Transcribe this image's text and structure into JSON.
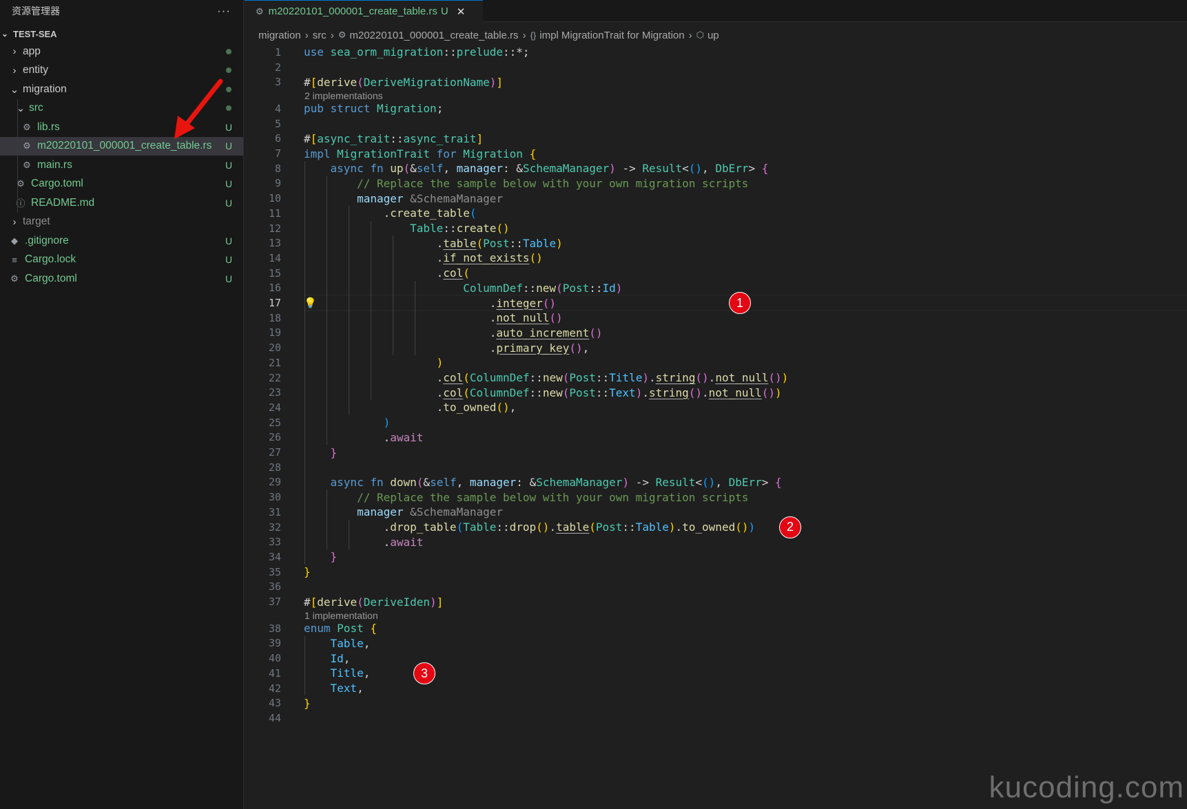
{
  "explorer": {
    "title": "资源管理器",
    "more": "···",
    "project": "TEST-SEA",
    "items": [
      {
        "label": "app",
        "kind": "folder",
        "open": false,
        "level": 0,
        "badge": "",
        "dot": true,
        "git": false,
        "selected": false
      },
      {
        "label": "entity",
        "kind": "folder",
        "open": false,
        "level": 0,
        "badge": "",
        "dot": true,
        "git": false,
        "selected": false
      },
      {
        "label": "migration",
        "kind": "folder",
        "open": true,
        "level": 0,
        "badge": "",
        "dot": true,
        "git": false,
        "selected": false
      },
      {
        "label": "src",
        "kind": "folder",
        "open": true,
        "level": 1,
        "badge": "",
        "dot": true,
        "git": true,
        "selected": false
      },
      {
        "label": "lib.rs",
        "kind": "rust",
        "open": false,
        "level": 2,
        "badge": "U",
        "dot": false,
        "git": true,
        "selected": false
      },
      {
        "label": "m20220101_000001_create_table.rs",
        "kind": "rust",
        "open": false,
        "level": 2,
        "badge": "U",
        "dot": false,
        "git": true,
        "selected": true
      },
      {
        "label": "main.rs",
        "kind": "rust",
        "open": false,
        "level": 2,
        "badge": "U",
        "dot": false,
        "git": true,
        "selected": false
      },
      {
        "label": "Cargo.toml",
        "kind": "gear",
        "open": false,
        "level": 1,
        "badge": "U",
        "dot": false,
        "git": true,
        "selected": false
      },
      {
        "label": "README.md",
        "kind": "info",
        "open": false,
        "level": 1,
        "badge": "U",
        "dot": false,
        "git": true,
        "selected": false
      },
      {
        "label": "target",
        "kind": "folder",
        "open": false,
        "level": 0,
        "badge": "",
        "dot": false,
        "git": false,
        "dim": true,
        "selected": false
      },
      {
        "label": ".gitignore",
        "kind": "diamond",
        "open": false,
        "level": 0,
        "badge": "U",
        "dot": false,
        "git": true,
        "selected": false
      },
      {
        "label": "Cargo.lock",
        "kind": "lines",
        "open": false,
        "level": 0,
        "badge": "U",
        "dot": false,
        "git": true,
        "selected": false
      },
      {
        "label": "Cargo.toml",
        "kind": "gear",
        "open": false,
        "level": 0,
        "badge": "U",
        "dot": false,
        "git": true,
        "selected": false
      }
    ]
  },
  "tab": {
    "label": "m20220101_000001_create_table.rs",
    "badge": "U",
    "close": "✕"
  },
  "breadcrumb": [
    {
      "label": "migration",
      "icon": ""
    },
    {
      "label": "src",
      "icon": ""
    },
    {
      "label": "m20220101_000001_create_table.rs",
      "icon": "rust-icon"
    },
    {
      "label": "impl MigrationTrait for Migration",
      "icon": "braces-icon"
    },
    {
      "label": "up",
      "icon": "cube-icon"
    }
  ],
  "editor": {
    "current_line": 17,
    "hints": [
      {
        "after_line": 3,
        "text": "2 implementations"
      },
      {
        "after_line": 37,
        "text": "1 implementation"
      }
    ],
    "lines": [
      [
        [
          "kw",
          "use"
        ],
        [
          "pl",
          " "
        ],
        [
          "ty",
          "sea_orm_migration"
        ],
        [
          "pl",
          "::"
        ],
        [
          "ty",
          "prelude"
        ],
        [
          "pl",
          "::*;"
        ]
      ],
      [],
      [
        [
          "pl",
          "#"
        ],
        [
          "b1",
          "["
        ],
        [
          "fn",
          "derive"
        ],
        [
          "b2",
          "("
        ],
        [
          "ty",
          "DeriveMigrationName"
        ],
        [
          "b2",
          ")"
        ],
        [
          "b1",
          "]"
        ]
      ],
      [
        [
          "kw",
          "pub"
        ],
        [
          "pl",
          " "
        ],
        [
          "kw",
          "struct"
        ],
        [
          "pl",
          " "
        ],
        [
          "ty",
          "Migration"
        ],
        [
          "pl",
          ";"
        ]
      ],
      [],
      [
        [
          "pl",
          "#"
        ],
        [
          "b1",
          "["
        ],
        [
          "ty",
          "async_trait"
        ],
        [
          "pl",
          "::"
        ],
        [
          "ty",
          "async_trait"
        ],
        [
          "b1",
          "]"
        ]
      ],
      [
        [
          "kw",
          "impl"
        ],
        [
          "pl",
          " "
        ],
        [
          "ty",
          "MigrationTrait"
        ],
        [
          "pl",
          " "
        ],
        [
          "kw",
          "for"
        ],
        [
          "pl",
          " "
        ],
        [
          "ty",
          "Migration"
        ],
        [
          "pl",
          " "
        ],
        [
          "b1",
          "{"
        ]
      ],
      [
        [
          "pl",
          "    "
        ],
        [
          "kw",
          "async"
        ],
        [
          "pl",
          " "
        ],
        [
          "kw",
          "fn"
        ],
        [
          "pl",
          " "
        ],
        [
          "fn",
          "up"
        ],
        [
          "b2",
          "("
        ],
        [
          "pl",
          "&"
        ],
        [
          "kw",
          "self"
        ],
        [
          "pl",
          ", "
        ],
        [
          "var",
          "manager"
        ],
        [
          "pl",
          ": &"
        ],
        [
          "ty",
          "SchemaManager"
        ],
        [
          "b2",
          ")"
        ],
        [
          "pl",
          " -> "
        ],
        [
          "ty",
          "Result"
        ],
        [
          "pl",
          "<"
        ],
        [
          "b3",
          "()"
        ],
        [
          "pl",
          ", "
        ],
        [
          "ty",
          "DbErr"
        ],
        [
          "pl",
          "> "
        ],
        [
          "b2",
          "{"
        ]
      ],
      [
        [
          "pl",
          "        "
        ],
        [
          "cm",
          "// Replace the sample below with your own migration scripts"
        ]
      ],
      [
        [
          "pl",
          "        "
        ],
        [
          "var",
          "manager"
        ],
        [
          "inh",
          " &SchemaManager"
        ]
      ],
      [
        [
          "pl",
          "            ."
        ],
        [
          "fn",
          "create_table"
        ],
        [
          "b3",
          "("
        ]
      ],
      [
        [
          "pl",
          "                "
        ],
        [
          "ty",
          "Table"
        ],
        [
          "pl",
          "::"
        ],
        [
          "fn",
          "create"
        ],
        [
          "b1",
          "()"
        ]
      ],
      [
        [
          "pl",
          "                    ."
        ],
        [
          "fn ul",
          "table"
        ],
        [
          "b1",
          "("
        ],
        [
          "ty",
          "Post"
        ],
        [
          "pl",
          "::"
        ],
        [
          "en",
          "Table"
        ],
        [
          "b1",
          ")"
        ]
      ],
      [
        [
          "pl",
          "                    ."
        ],
        [
          "fn ul",
          "if_not_exists"
        ],
        [
          "b1",
          "()"
        ]
      ],
      [
        [
          "pl",
          "                    ."
        ],
        [
          "fn ul",
          "col"
        ],
        [
          "b1",
          "("
        ]
      ],
      [
        [
          "pl",
          "                        "
        ],
        [
          "ty",
          "ColumnDef"
        ],
        [
          "pl",
          "::"
        ],
        [
          "fn",
          "new"
        ],
        [
          "b2",
          "("
        ],
        [
          "ty",
          "Post"
        ],
        [
          "pl",
          "::"
        ],
        [
          "en",
          "Id"
        ],
        [
          "b2",
          ")"
        ]
      ],
      [
        [
          "pl",
          "                            ."
        ],
        [
          "fn ul",
          "integer"
        ],
        [
          "b2",
          "()"
        ]
      ],
      [
        [
          "pl",
          "                            ."
        ],
        [
          "fn ul",
          "not_null"
        ],
        [
          "b2",
          "()"
        ]
      ],
      [
        [
          "pl",
          "                            ."
        ],
        [
          "fn ul",
          "auto_increment"
        ],
        [
          "b2",
          "()"
        ]
      ],
      [
        [
          "pl",
          "                            ."
        ],
        [
          "fn ul",
          "primary_key"
        ],
        [
          "b2",
          "()"
        ],
        [
          "pl",
          ","
        ]
      ],
      [
        [
          "pl",
          "                    "
        ],
        [
          "b1",
          ")"
        ]
      ],
      [
        [
          "pl",
          "                    ."
        ],
        [
          "fn ul",
          "col"
        ],
        [
          "b1",
          "("
        ],
        [
          "ty",
          "ColumnDef"
        ],
        [
          "pl",
          "::"
        ],
        [
          "fn",
          "new"
        ],
        [
          "b2",
          "("
        ],
        [
          "ty",
          "Post"
        ],
        [
          "pl",
          "::"
        ],
        [
          "en",
          "Title"
        ],
        [
          "b2",
          ")"
        ],
        [
          "pl",
          "."
        ],
        [
          "fn ul",
          "string"
        ],
        [
          "b2",
          "()"
        ],
        [
          "pl",
          "."
        ],
        [
          "fn ul",
          "not_null"
        ],
        [
          "b2",
          "()"
        ],
        [
          "b1",
          ")"
        ]
      ],
      [
        [
          "pl",
          "                    ."
        ],
        [
          "fn ul",
          "col"
        ],
        [
          "b1",
          "("
        ],
        [
          "ty",
          "ColumnDef"
        ],
        [
          "pl",
          "::"
        ],
        [
          "fn",
          "new"
        ],
        [
          "b2",
          "("
        ],
        [
          "ty",
          "Post"
        ],
        [
          "pl",
          "::"
        ],
        [
          "en",
          "Text"
        ],
        [
          "b2",
          ")"
        ],
        [
          "pl",
          "."
        ],
        [
          "fn ul",
          "string"
        ],
        [
          "b2",
          "()"
        ],
        [
          "pl",
          "."
        ],
        [
          "fn ul",
          "not_null"
        ],
        [
          "b2",
          "()"
        ],
        [
          "b1",
          ")"
        ]
      ],
      [
        [
          "pl",
          "                    ."
        ],
        [
          "fn",
          "to_owned"
        ],
        [
          "b1",
          "()"
        ],
        [
          "pl",
          ","
        ]
      ],
      [
        [
          "pl",
          "            "
        ],
        [
          "b3",
          ")"
        ]
      ],
      [
        [
          "pl",
          "            ."
        ],
        [
          "ctl",
          "await"
        ]
      ],
      [
        [
          "pl",
          "    "
        ],
        [
          "b2",
          "}"
        ]
      ],
      [],
      [
        [
          "pl",
          "    "
        ],
        [
          "kw",
          "async"
        ],
        [
          "pl",
          " "
        ],
        [
          "kw",
          "fn"
        ],
        [
          "pl",
          " "
        ],
        [
          "fn",
          "down"
        ],
        [
          "b2",
          "("
        ],
        [
          "pl",
          "&"
        ],
        [
          "kw",
          "self"
        ],
        [
          "pl",
          ", "
        ],
        [
          "var",
          "manager"
        ],
        [
          "pl",
          ": &"
        ],
        [
          "ty",
          "SchemaManager"
        ],
        [
          "b2",
          ")"
        ],
        [
          "pl",
          " -> "
        ],
        [
          "ty",
          "Result"
        ],
        [
          "pl",
          "<"
        ],
        [
          "b3",
          "()"
        ],
        [
          "pl",
          ", "
        ],
        [
          "ty",
          "DbErr"
        ],
        [
          "pl",
          "> "
        ],
        [
          "b2",
          "{"
        ]
      ],
      [
        [
          "pl",
          "        "
        ],
        [
          "cm",
          "// Replace the sample below with your own migration scripts"
        ]
      ],
      [
        [
          "pl",
          "        "
        ],
        [
          "var",
          "manager"
        ],
        [
          "inh",
          " &SchemaManager"
        ]
      ],
      [
        [
          "pl",
          "            ."
        ],
        [
          "fn",
          "drop_table"
        ],
        [
          "b3",
          "("
        ],
        [
          "ty",
          "Table"
        ],
        [
          "pl",
          "::"
        ],
        [
          "fn",
          "drop"
        ],
        [
          "b1",
          "()"
        ],
        [
          "pl",
          "."
        ],
        [
          "fn ul",
          "table"
        ],
        [
          "b1",
          "("
        ],
        [
          "ty",
          "Post"
        ],
        [
          "pl",
          "::"
        ],
        [
          "en",
          "Table"
        ],
        [
          "b1",
          ")"
        ],
        [
          "pl",
          "."
        ],
        [
          "fn",
          "to_owned"
        ],
        [
          "b1",
          "()"
        ],
        [
          "b3",
          ")"
        ]
      ],
      [
        [
          "pl",
          "            ."
        ],
        [
          "ctl",
          "await"
        ]
      ],
      [
        [
          "pl",
          "    "
        ],
        [
          "b2",
          "}"
        ]
      ],
      [
        [
          "b1",
          "}"
        ]
      ],
      [],
      [
        [
          "pl",
          "#"
        ],
        [
          "b1",
          "["
        ],
        [
          "fn",
          "derive"
        ],
        [
          "b2",
          "("
        ],
        [
          "ty",
          "DeriveIden"
        ],
        [
          "b2",
          ")"
        ],
        [
          "b1",
          "]"
        ]
      ],
      [
        [
          "kw",
          "enum"
        ],
        [
          "pl",
          " "
        ],
        [
          "ty",
          "Post"
        ],
        [
          "pl",
          " "
        ],
        [
          "b1",
          "{"
        ]
      ],
      [
        [
          "pl",
          "    "
        ],
        [
          "en",
          "Table"
        ],
        [
          "pl",
          ","
        ]
      ],
      [
        [
          "pl",
          "    "
        ],
        [
          "en",
          "Id"
        ],
        [
          "pl",
          ","
        ]
      ],
      [
        [
          "pl",
          "    "
        ],
        [
          "en",
          "Title"
        ],
        [
          "pl",
          ","
        ]
      ],
      [
        [
          "pl",
          "    "
        ],
        [
          "en",
          "Text"
        ],
        [
          "pl",
          ","
        ]
      ],
      [
        [
          "b1",
          "}"
        ]
      ],
      []
    ]
  },
  "annotations": [
    {
      "label": "1",
      "line": 17
    },
    {
      "label": "2",
      "line": 32
    },
    {
      "label": "3",
      "line": 41
    }
  ],
  "watermark": "kucoding.com",
  "colors": {
    "accent": "#0078d4",
    "git_untracked": "#73c991",
    "annotation_red": "#e30613"
  }
}
